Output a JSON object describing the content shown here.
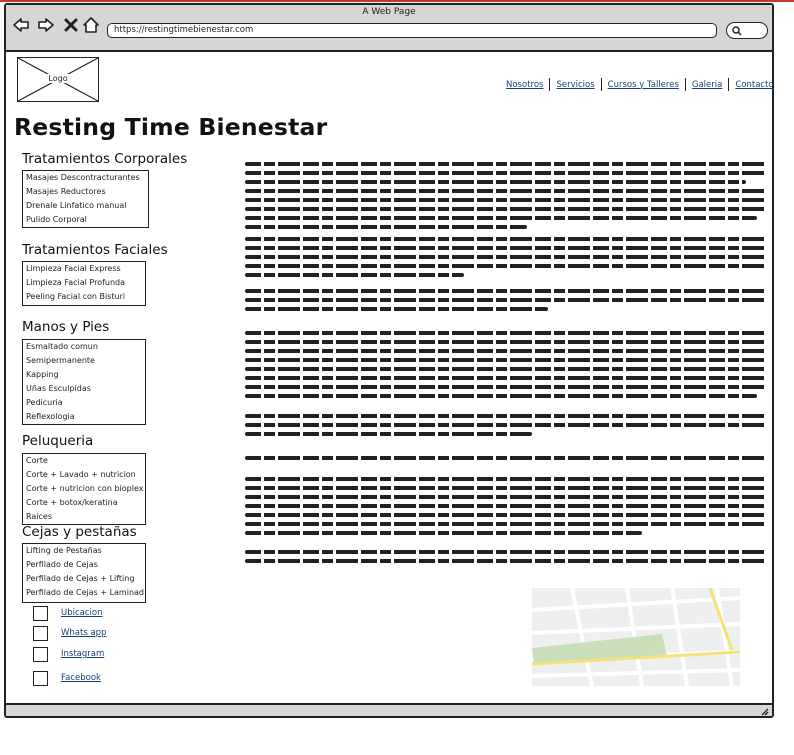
{
  "browser": {
    "window_title": "A Web Page",
    "url": "https://restingtimebienestar.com"
  },
  "logo": {
    "label": "Logo"
  },
  "nav": {
    "items": [
      "Nosotros",
      "Servicios",
      "Cursos y Talleres",
      "Galeria",
      "Contacto"
    ]
  },
  "site": {
    "title": "Resting Time Bienestar"
  },
  "sections": [
    {
      "title": "Tratamientos Corporales",
      "items": [
        "Masajes Descontracturantes",
        "Masajes Reductores",
        "Drenale Linfatico manual",
        "Pulido Corporal"
      ]
    },
    {
      "title": "Tratamientos Faciales",
      "items": [
        "Limpieza Facial Express",
        "Limpieza Facial Profunda",
        "Peeling Facial con Bisturi"
      ]
    },
    {
      "title": "Manos y Pies",
      "items": [
        "Esmaltado comun",
        "Semipermanente",
        "Kapping",
        "Uñas Esculpidas",
        "Pedicuria",
        "Reflexologia"
      ]
    },
    {
      "title": "Peluqueria",
      "items": [
        "Corte",
        "Corte + Lavado + nutricion",
        "Corte + nutricion con bioplex",
        "Corte + botox/keratina",
        "Raices"
      ]
    },
    {
      "title": "Cejas y pestañas",
      "items": [
        "Lifting de Pestañas",
        "Perfilado de Cejas",
        "Perfilado de Cejas + Lifting",
        "Perfilado de Cejas + Laminad"
      ]
    }
  ],
  "social": [
    "Ubicacion",
    "Whats app",
    "Instagram",
    "Facebook"
  ]
}
